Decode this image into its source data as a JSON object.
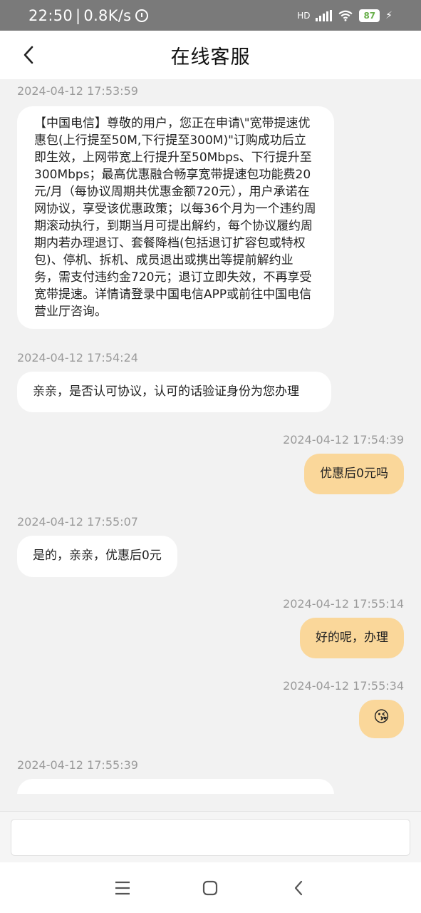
{
  "status_bar": {
    "time": "22:50",
    "speed": "0.8K/s",
    "network": "HD",
    "battery": "87"
  },
  "header": {
    "title": "在线客服"
  },
  "messages": [
    {
      "time": "2024-04-12 17:53:59",
      "text": "【中国电信】尊敬的用户，您正在申请\\\"宽带提速优惠包(上行提至50M,下行提至300M)\"订购成功后立即生效，上网带宽上行提升至50Mbps、下行提升至300Mbps；最高优惠融合畅享宽带提速包功能费20元/月（每协议周期共优惠金额720元），用户承诺在网协议，享受该优惠政策；以每36个月为一个违约周期滚动执行，到期当月可提出解约，每个协议履约周期内若办理退订、套餐降档(包括退订扩容包或特权包)、停机、拆机、成员退出或携出等提前解约业务，需支付违约金720元；退订立即失效，不再享受宽带提速。详情请登录中国电信APP或前往中国电信营业厅咨询。"
    },
    {
      "time": "2024-04-12 17:54:24",
      "text": "亲亲，是否认可协议，认可的话验证身份为您办理"
    },
    {
      "time": "2024-04-12 17:54:39",
      "text": "优惠后0元吗"
    },
    {
      "time": "2024-04-12 17:55:07",
      "text": "是的，亲亲，优惠后0元"
    },
    {
      "time": "2024-04-12 17:55:14",
      "text": "好的呢，办理"
    },
    {
      "time": "2024-04-12 17:55:34",
      "text": "😘"
    },
    {
      "time": "2024-04-12 17:55:39",
      "text": ""
    }
  ],
  "input": {
    "placeholder": ""
  },
  "colors": {
    "incoming_bubble": "#ffffff",
    "outgoing_bubble": "#fad79a",
    "background": "#f2f2f2"
  }
}
